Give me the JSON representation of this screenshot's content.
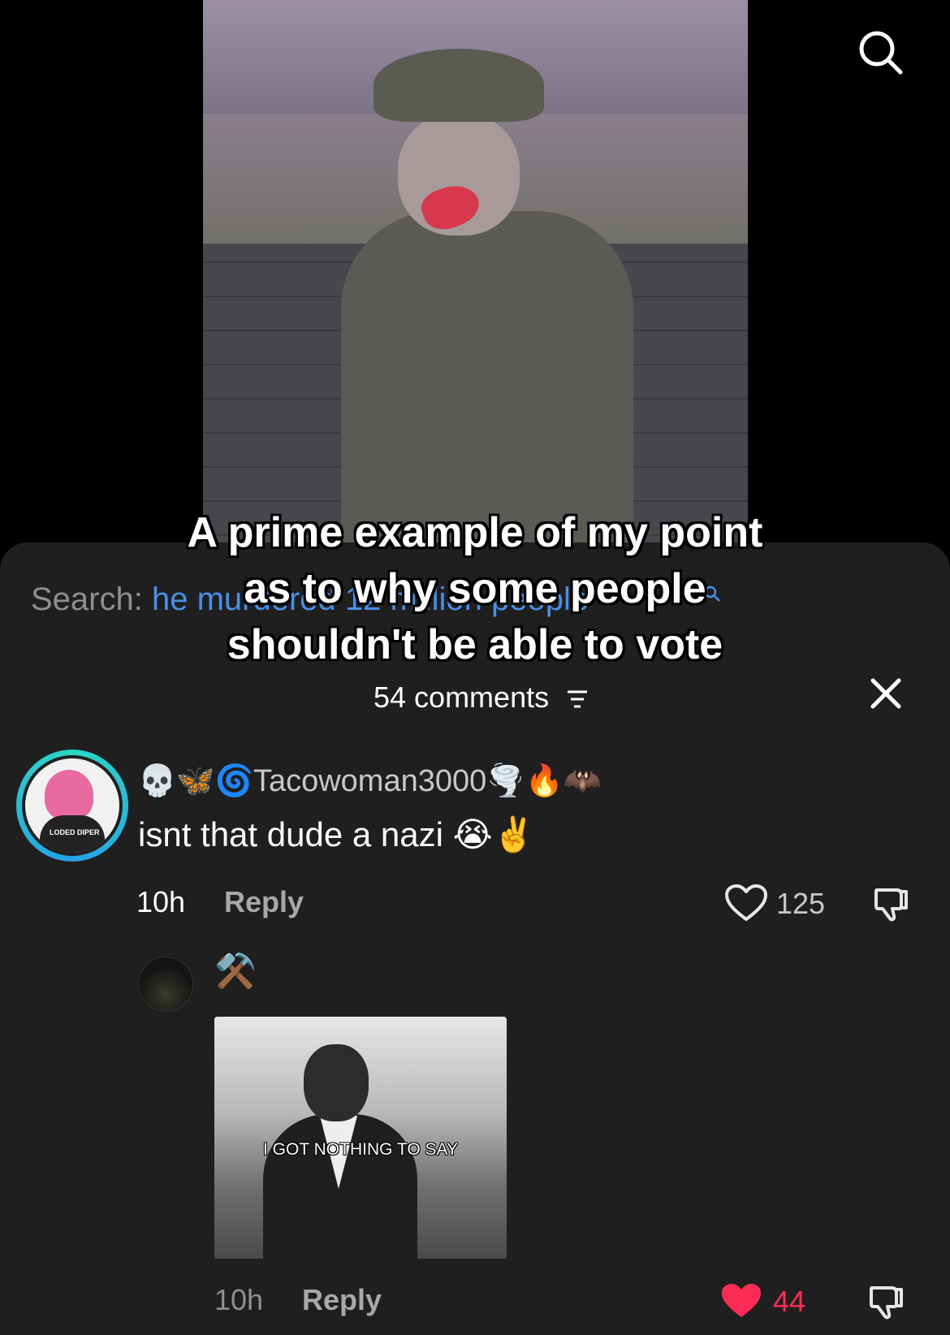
{
  "video": {
    "caption": "A prime example of my point as to why some people shouldn't be able to vote"
  },
  "header": {
    "search_icon": "search-icon"
  },
  "sheet": {
    "search_label": "Search:",
    "search_query": "he murdered 12 million people",
    "comment_count": "54 comments",
    "sort_icon": "filter-lines-icon",
    "close_icon": "close-icon"
  },
  "comments": [
    {
      "username": "💀🦋🌀Tacowoman3000🌪️🔥🦇",
      "text": "isnt that dude a nazi 😭✌️",
      "time": "10h",
      "reply_label": "Reply",
      "likes": "125",
      "liked": false,
      "avatar_text": "LODED DIPER"
    },
    {
      "username": "⚒️",
      "gif_caption": "I GOT NOTHING TO SAY",
      "time": "10h",
      "reply_label": "Reply",
      "likes": "44",
      "liked": true
    }
  ],
  "colors": {
    "sheet_bg": "#1f1f1f",
    "search_query": "#4a8fe7",
    "liked_heart": "#fe2c55",
    "avatar_ring": "#2ad7c3"
  }
}
